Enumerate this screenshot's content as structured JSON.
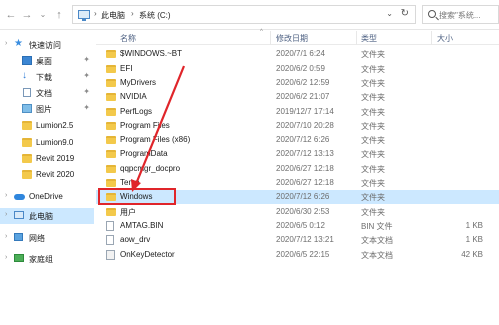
{
  "address_bar": {
    "back": "←",
    "forward": "→",
    "dropdown": "⌄",
    "up": "↑",
    "crumbs": [
      "此电脑",
      "系统 (C:)"
    ],
    "crumb_sep": "›",
    "refresh": "↻",
    "addr_dropdown": "⌄",
    "search_placeholder": "搜索\"系统..."
  },
  "sidebar": {
    "items": [
      {
        "label": "快速访问",
        "icon": "star-icon"
      },
      {
        "label": "桌面",
        "icon": "desktop-icon",
        "pinned": true
      },
      {
        "label": "下载",
        "icon": "download-icon",
        "pinned": true
      },
      {
        "label": "文档",
        "icon": "document-icon",
        "pinned": true
      },
      {
        "label": "图片",
        "icon": "picture-icon",
        "pinned": true
      },
      {
        "label": "Lumion2.5",
        "icon": "folder-icon"
      },
      {
        "label": "Lumion9.0",
        "icon": "folder-icon"
      },
      {
        "label": "Revit 2019",
        "icon": "folder-icon"
      },
      {
        "label": "Revit 2020",
        "icon": "folder-icon"
      },
      {
        "label": "OneDrive",
        "icon": "cloud-icon"
      },
      {
        "label": "此电脑",
        "icon": "computer-icon"
      },
      {
        "label": "网络",
        "icon": "network-icon"
      },
      {
        "label": "家庭组",
        "icon": "homegroup-icon"
      }
    ],
    "pin_glyph": "📌"
  },
  "columns": {
    "name": "名称",
    "date": "修改日期",
    "type": "类型",
    "size": "大小",
    "sort_glyph": "^"
  },
  "files": [
    {
      "name": "$WINDOWS.~BT",
      "date": "2020/7/1 6:24",
      "type": "文件夹",
      "size": "",
      "kind": "folder"
    },
    {
      "name": "EFI",
      "date": "2020/6/2 0:59",
      "type": "文件夹",
      "size": "",
      "kind": "folder"
    },
    {
      "name": "MyDrivers",
      "date": "2020/6/2 12:59",
      "type": "文件夹",
      "size": "",
      "kind": "folder"
    },
    {
      "name": "NVIDIA",
      "date": "2020/6/2 21:07",
      "type": "文件夹",
      "size": "",
      "kind": "folder"
    },
    {
      "name": "PerfLogs",
      "date": "2019/12/7 17:14",
      "type": "文件夹",
      "size": "",
      "kind": "folder"
    },
    {
      "name": "Program Files",
      "date": "2020/7/10 20:28",
      "type": "文件夹",
      "size": "",
      "kind": "folder"
    },
    {
      "name": "Program Files (x86)",
      "date": "2020/7/12 6:26",
      "type": "文件夹",
      "size": "",
      "kind": "folder"
    },
    {
      "name": "ProgramData",
      "date": "2020/7/12 13:13",
      "type": "文件夹",
      "size": "",
      "kind": "folder"
    },
    {
      "name": "qqpcmgr_docpro",
      "date": "2020/6/27 12:18",
      "type": "文件夹",
      "size": "",
      "kind": "folder"
    },
    {
      "name": "Temp",
      "date": "2020/6/27 12:18",
      "type": "文件夹",
      "size": "",
      "kind": "folder"
    },
    {
      "name": "Windows",
      "date": "2020/7/12 6:26",
      "type": "文件夹",
      "size": "",
      "kind": "folder",
      "selected": true
    },
    {
      "name": "用户",
      "date": "2020/6/30 2:53",
      "type": "文件夹",
      "size": "",
      "kind": "folder"
    },
    {
      "name": "AMTAG.BIN",
      "date": "2020/6/5 0:12",
      "type": "BIN 文件",
      "size": "1 KB",
      "kind": "file"
    },
    {
      "name": "aow_drv",
      "date": "2020/7/12 13:21",
      "type": "文本文档",
      "size": "1 KB",
      "kind": "file"
    },
    {
      "name": "OnKeyDetector",
      "date": "2020/6/5 22:15",
      "type": "文本文档",
      "size": "42 KB",
      "kind": "exe"
    }
  ],
  "colors": {
    "selection": "#cce8ff",
    "annotation": "#e0252a",
    "folder": "#f3c94b"
  }
}
